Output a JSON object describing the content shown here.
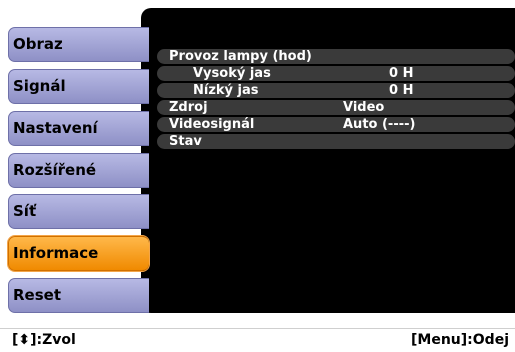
{
  "menu": {
    "items": [
      {
        "label": "Obraz",
        "active": false
      },
      {
        "label": "Signál",
        "active": false
      },
      {
        "label": "Nastavení",
        "active": false
      },
      {
        "label": "Rozšířené",
        "active": false
      },
      {
        "label": "Síť",
        "active": false
      },
      {
        "label": "Informace",
        "active": true
      },
      {
        "label": "Reset",
        "active": false
      }
    ]
  },
  "info": {
    "lamp_hours_label": "Provoz lampy (hod)",
    "high_brightness_label": "Vysoký jas",
    "high_brightness_value": "0 H",
    "low_brightness_label": "Nízký jas",
    "low_brightness_value": "0 H",
    "source_label": "Zdroj",
    "source_value": "Video",
    "video_signal_label": "Videosignál",
    "video_signal_value": "Auto (----)",
    "status_label": "Stav"
  },
  "footer": {
    "select_hint": "[⬍]:Zvol",
    "exit_hint": "[Menu]:Odej"
  },
  "colors": {
    "menu_bg": "#9fa1d6",
    "active_bg": "#f79a1c",
    "panel_bg": "#000000",
    "row_bg": "#3a3a3a"
  }
}
